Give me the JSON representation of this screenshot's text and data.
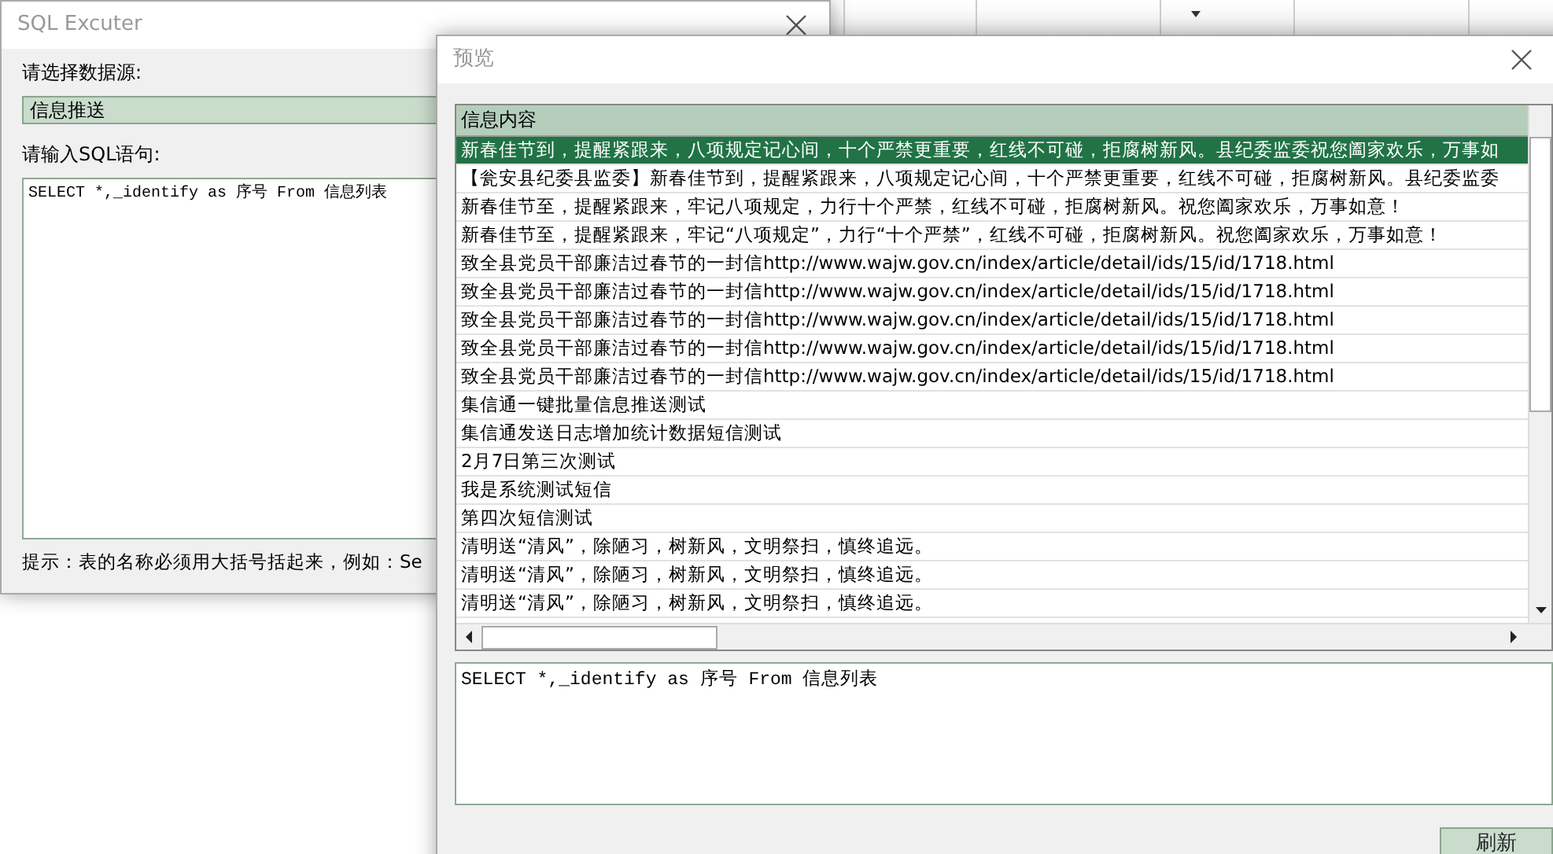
{
  "sql_window": {
    "title": "SQL Excuter",
    "source_label": "请选择数据源:",
    "source_value": "信息推送",
    "sql_label": "请输入SQL语句:",
    "sql_text": "SELECT *,_identify as 序号 From 信息列表",
    "hint": "提示：表的名称必须用大括号括起来，例如：Se"
  },
  "preview_window": {
    "title": "预览",
    "grid": {
      "columns": [
        "信息内容"
      ],
      "rows": [
        {
          "text": "新春佳节到，提醒紧跟来，八项规定记心间，十个严禁更重要，红线不可碰，拒腐树新风。县纪委监委祝您阖家欢乐，万事如",
          "selected": true
        },
        {
          "text": "【瓮安县纪委县监委】新春佳节到，提醒紧跟来，八项规定记心间，十个严禁更重要，红线不可碰，拒腐树新风。县纪委监委",
          "selected": false
        },
        {
          "text": "新春佳节至，提醒紧跟来，牢记八项规定，力行十个严禁，红线不可碰，拒腐树新风。祝您阖家欢乐，万事如意！",
          "selected": false
        },
        {
          "text": "新春佳节至，提醒紧跟来，牢记“八项规定”，力行“十个严禁”，红线不可碰，拒腐树新风。祝您阖家欢乐，万事如意！",
          "selected": false
        },
        {
          "text": "致全县党员干部廉洁过春节的一封信http://www.wajw.gov.cn/index/article/detail/ids/15/id/1718.html",
          "selected": false
        },
        {
          "text": "致全县党员干部廉洁过春节的一封信http://www.wajw.gov.cn/index/article/detail/ids/15/id/1718.html",
          "selected": false
        },
        {
          "text": "致全县党员干部廉洁过春节的一封信http://www.wajw.gov.cn/index/article/detail/ids/15/id/1718.html",
          "selected": false
        },
        {
          "text": "致全县党员干部廉洁过春节的一封信http://www.wajw.gov.cn/index/article/detail/ids/15/id/1718.html",
          "selected": false
        },
        {
          "text": "致全县党员干部廉洁过春节的一封信http://www.wajw.gov.cn/index/article/detail/ids/15/id/1718.html",
          "selected": false
        },
        {
          "text": "集信通一键批量信息推送测试",
          "selected": false
        },
        {
          "text": "集信通发送日志增加统计数据短信测试",
          "selected": false
        },
        {
          "text": "2月7日第三次测试",
          "selected": false
        },
        {
          "text": "我是系统测试短信",
          "selected": false
        },
        {
          "text": "第四次短信测试",
          "selected": false
        },
        {
          "text": "清明送“清风”，除陋习，树新风，文明祭扫，慎终追远。",
          "selected": false
        },
        {
          "text": "清明送“清风”，除陋习，树新风，文明祭扫，慎终追远。",
          "selected": false
        },
        {
          "text": "清明送“清风”，除陋习，树新风，文明祭扫，慎终追远。",
          "selected": false
        }
      ]
    },
    "sql_text": "SELECT *,_identify as 序号 From 信息列表",
    "buttons": [
      "刷新"
    ]
  }
}
